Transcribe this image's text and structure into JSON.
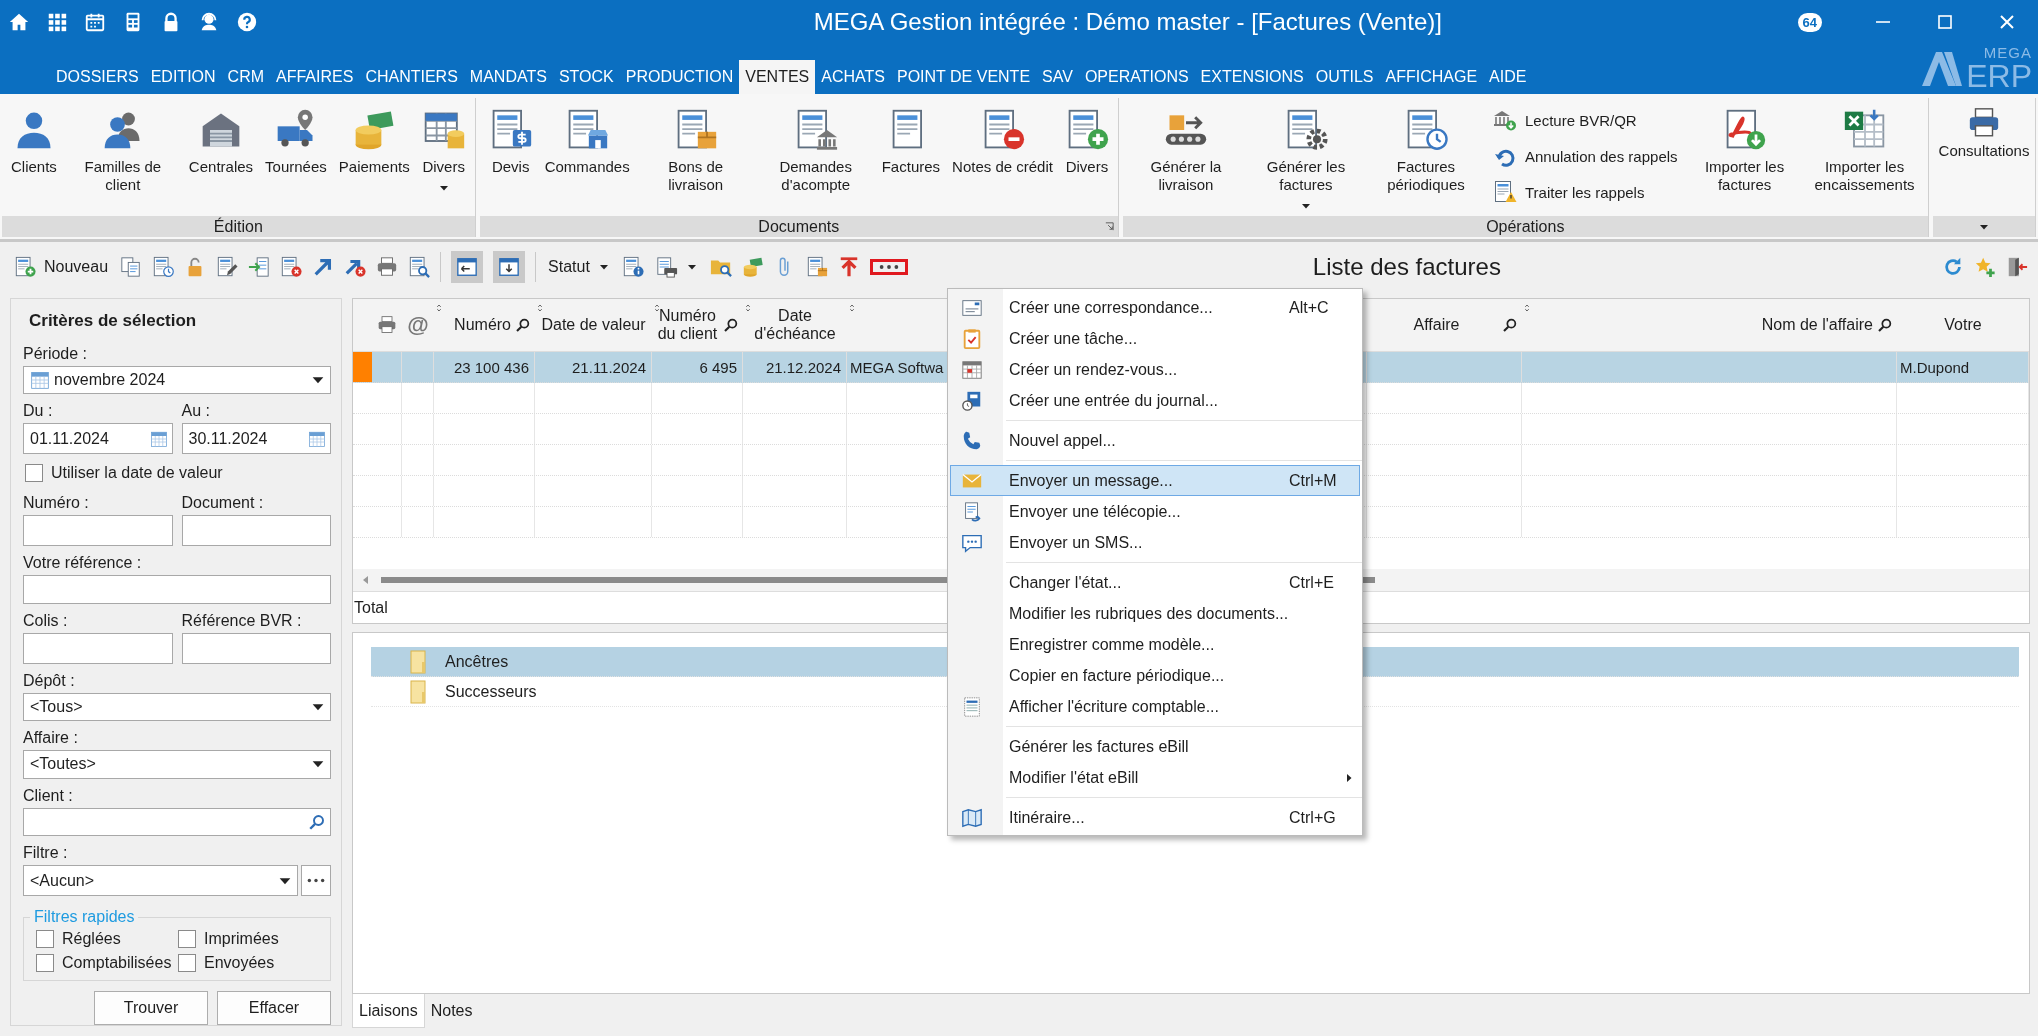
{
  "window": {
    "title": "MEGA Gestion intégrée : Démo master - [Factures (Vente)]",
    "badge": "64"
  },
  "menu_tabs": [
    {
      "label": "DOSSIERS",
      "selected": false
    },
    {
      "label": "EDITION",
      "selected": false
    },
    {
      "label": "CRM",
      "selected": false
    },
    {
      "label": "AFFAIRES",
      "selected": false
    },
    {
      "label": "CHANTIERS",
      "selected": false
    },
    {
      "label": "MANDATS",
      "selected": false
    },
    {
      "label": "STOCK",
      "selected": false
    },
    {
      "label": "PRODUCTION",
      "selected": false
    },
    {
      "label": "VENTES",
      "selected": true
    },
    {
      "label": "ACHATS",
      "selected": false
    },
    {
      "label": "POINT DE VENTE",
      "selected": false
    },
    {
      "label": "SAV",
      "selected": false
    },
    {
      "label": "OPERATIONS",
      "selected": false
    },
    {
      "label": "EXTENSIONS",
      "selected": false
    },
    {
      "label": "OUTILS",
      "selected": false
    },
    {
      "label": "AFFICHAGE",
      "selected": false
    },
    {
      "label": "AIDE",
      "selected": false
    }
  ],
  "logo": {
    "line_1": "MEGA",
    "line_2": "ERP"
  },
  "ribbon": {
    "groups": [
      {
        "label": "Édition",
        "launcher": false,
        "items": [
          {
            "kind": "large",
            "label": "Clients",
            "dropdown": false
          },
          {
            "kind": "large",
            "label": "Familles de client",
            "dropdown": false
          },
          {
            "kind": "large",
            "label": "Centrales",
            "dropdown": false
          },
          {
            "kind": "large",
            "label": "Tournées",
            "dropdown": false
          },
          {
            "kind": "large",
            "label": "Paiements",
            "dropdown": false
          },
          {
            "kind": "large",
            "label": "Divers",
            "dropdown": true
          }
        ]
      },
      {
        "label": "Documents",
        "launcher": true,
        "items": [
          {
            "kind": "large",
            "label": "Devis",
            "dropdown": false
          },
          {
            "kind": "large",
            "label": "Commandes",
            "dropdown": false
          },
          {
            "kind": "large",
            "label": "Bons de livraison",
            "dropdown": false
          },
          {
            "kind": "large",
            "label": "Demandes d'acompte",
            "dropdown": false
          },
          {
            "kind": "large",
            "label": "Factures",
            "dropdown": false
          },
          {
            "kind": "large",
            "label": "Notes de crédit",
            "dropdown": false
          },
          {
            "kind": "large",
            "label": "Divers",
            "dropdown": false
          }
        ]
      },
      {
        "label": "Opérations",
        "launcher": false,
        "items": [
          {
            "kind": "large",
            "label": "Générer la livraison",
            "dropdown": false
          },
          {
            "kind": "large",
            "label": "Générer les factures",
            "dropdown": true
          },
          {
            "kind": "large",
            "label": "Factures périodiques",
            "dropdown": false
          },
          {
            "kind": "small",
            "label": "Lecture BVR/QR",
            "dropdown": false
          },
          {
            "kind": "small",
            "label": "Annulation des rappels",
            "dropdown": false
          },
          {
            "kind": "small",
            "label": "Traiter les rappels",
            "dropdown": false
          },
          {
            "kind": "large",
            "label": "Importer les factures",
            "dropdown": false
          },
          {
            "kind": "large",
            "label": "Importer les encaissements",
            "dropdown": false
          }
        ]
      },
      {
        "launcher": false,
        "items": [
          {
            "kind": "top",
            "label": "Consultations",
            "dropdown": false
          }
        ]
      }
    ]
  },
  "toolbar": {
    "new_label": "Nouveau",
    "status_label": "Statut",
    "view_toggles": [
      {
        "pressed": true
      },
      {
        "pressed": true
      }
    ],
    "more_button": {
      "outlined": true
    }
  },
  "page_title": "Liste des factures",
  "criteria": {
    "title": "Critères de sélection",
    "periode": {
      "label": "Période :",
      "value": "novembre 2024"
    },
    "du": {
      "label": "Du :",
      "value": "01.11.2024"
    },
    "au": {
      "label": "Au :",
      "value": "30.11.2024"
    },
    "use_value_date": {
      "label": "Utiliser la date de valeur",
      "checked": false
    },
    "numero": {
      "label": "Numéro :"
    },
    "document": {
      "label": "Document :"
    },
    "votre_reference": {
      "label": "Votre référence :"
    },
    "colis": {
      "label": "Colis :"
    },
    "reference_bvr": {
      "label": "Référence BVR :"
    },
    "depot": {
      "label": "Dépôt :",
      "value": "<Tous>"
    },
    "affaire": {
      "label": "Affaire :",
      "value": "<Toutes>"
    },
    "client": {
      "label": "Client :"
    },
    "filtre": {
      "label": "Filtre :",
      "value": "<Aucun>"
    },
    "quick_filters": {
      "title": "Filtres rapides",
      "options": [
        {
          "label": "Réglées",
          "checked": false
        },
        {
          "label": "Imprimées",
          "checked": false
        },
        {
          "label": "Comptabilisées",
          "checked": false
        },
        {
          "label": "Envoyées",
          "checked": false
        }
      ]
    },
    "buttons": [
      "Trouver",
      "Effacer"
    ]
  },
  "table": {
    "columns": [
      {
        "kind": "marker"
      },
      {
        "kind": "icon"
      },
      {
        "kind": "glyph",
        "label": "@"
      },
      {
        "kind": "text",
        "label": "Numéro",
        "search": true
      },
      {
        "kind": "text",
        "label": "Date de valeur",
        "search": false
      },
      {
        "kind": "text",
        "label": "Numéro du client",
        "search": true
      },
      {
        "kind": "text",
        "label": "Date d'échéance",
        "search": false
      },
      {
        "kind": "text"
      },
      {
        "kind": "text",
        "label": "Affaire",
        "search": true
      },
      {
        "kind": "text",
        "label": "Nom de l'affaire",
        "search": true
      },
      {
        "kind": "text",
        "label": "Votre",
        "search": false
      }
    ],
    "rows": [
      {
        "selected": true,
        "color": "#ff8000",
        "cells": [
          "",
          "",
          "",
          "23 100 436",
          "21.11.2024",
          "6 495",
          "21.12.2024",
          "MEGA Softwa",
          "",
          "",
          "M.Dupond"
        ]
      }
    ],
    "total_label": "Total"
  },
  "links": {
    "items": [
      {
        "label": "Ancêtres",
        "selected": true
      },
      {
        "label": "Successeurs",
        "selected": false
      }
    ]
  },
  "bottom_tabs": [
    {
      "label": "Liaisons",
      "selected": true
    },
    {
      "label": "Notes",
      "selected": false
    }
  ],
  "context_menu": {
    "groups": [
      {
        "items": [
          {
            "label": "Créer une correspondance...",
            "shortcut": "Alt+C",
            "selected": false,
            "submenu": false
          },
          {
            "label": "Créer une tâche...",
            "selected": false,
            "submenu": false
          },
          {
            "label": "Créer un rendez-vous...",
            "selected": false,
            "submenu": false
          },
          {
            "label": "Créer une entrée du journal...",
            "selected": false,
            "submenu": false
          }
        ]
      },
      {
        "items": [
          {
            "label": "Nouvel appel...",
            "selected": false,
            "submenu": false
          }
        ]
      },
      {
        "items": [
          {
            "label": "Envoyer un message...",
            "shortcut": "Ctrl+M",
            "selected": true,
            "submenu": false
          },
          {
            "label": "Envoyer une télécopie...",
            "selected": false,
            "submenu": false
          },
          {
            "label": "Envoyer un SMS...",
            "selected": false,
            "submenu": false
          }
        ]
      },
      {
        "items": [
          {
            "label": "Changer l'état...",
            "shortcut": "Ctrl+E",
            "selected": false,
            "submenu": false
          },
          {
            "label": "Modifier les rubriques des documents...",
            "selected": false,
            "submenu": false
          },
          {
            "label": "Enregistrer comme modèle...",
            "selected": false,
            "submenu": false
          },
          {
            "label": "Copier en facture périodique...",
            "selected": false,
            "submenu": false
          },
          {
            "label": "Afficher l'écriture comptable...",
            "selected": false,
            "submenu": false
          }
        ]
      },
      {
        "items": [
          {
            "label": "Générer les factures eBill",
            "selected": false,
            "submenu": false
          },
          {
            "label": "Modifier l'état eBill",
            "selected": false,
            "submenu": true
          }
        ]
      },
      {
        "items": [
          {
            "label": "Itinéraire...",
            "shortcut": "Ctrl+G",
            "selected": false,
            "submenu": false
          }
        ]
      }
    ]
  }
}
